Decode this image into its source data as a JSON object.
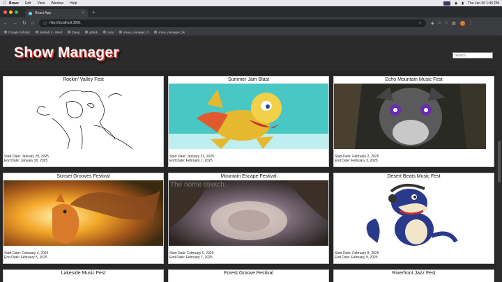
{
  "menubar": {
    "items": [
      "Brave",
      "Edit",
      "View",
      "Window",
      "Help"
    ],
    "clock": "Thu Jan 30 1:46 PM"
  },
  "browser": {
    "tab_title": "React App",
    "url": "http://localhost:3001",
    "bookmarks": [
      "Google Scholar",
      "Nethub 4 - Ment",
      "Dang",
      "github",
      "todo",
      "show_manager_fr",
      "show_manager_bk"
    ]
  },
  "app": {
    "title": "Show Manager",
    "search_placeholder": "Search..."
  },
  "shows": [
    {
      "name": "Rockin' Valley Fest",
      "start": "Start Date: January 29, 2025",
      "end": "End Date: January 30, 2025"
    },
    {
      "name": "Summer Jam Blast",
      "start": "Start Date: January 31, 2025",
      "end": "End Date: February 1, 2025"
    },
    {
      "name": "Echo Mountain Music Fest",
      "start": "Start Date: February 2, 2025",
      "end": "End Date: February 3, 2025"
    },
    {
      "name": "Sunset Grooves Festival",
      "start": "Start Date: February 4, 2025",
      "end": "End Date: February 5, 2025"
    },
    {
      "name": "Mountain Escape Festival",
      "start": "Start Date: February 6, 2025",
      "end": "End Date: February 7, 2025",
      "overlay": "The nome stretch:"
    },
    {
      "name": "Desert Beats Music Fest",
      "start": "Start Date: February 8, 2025",
      "end": "End Date: February 9, 2025"
    },
    {
      "name": "Lakeside Music Fest"
    },
    {
      "name": "Forest Groove Festival"
    },
    {
      "name": "Riverfront Jazz Fest"
    }
  ],
  "colors": {
    "page_bg": "#262626",
    "header_bg": "#2b2b2b",
    "card_bg": "#ffffff",
    "title_shadow": "#d4453a"
  }
}
